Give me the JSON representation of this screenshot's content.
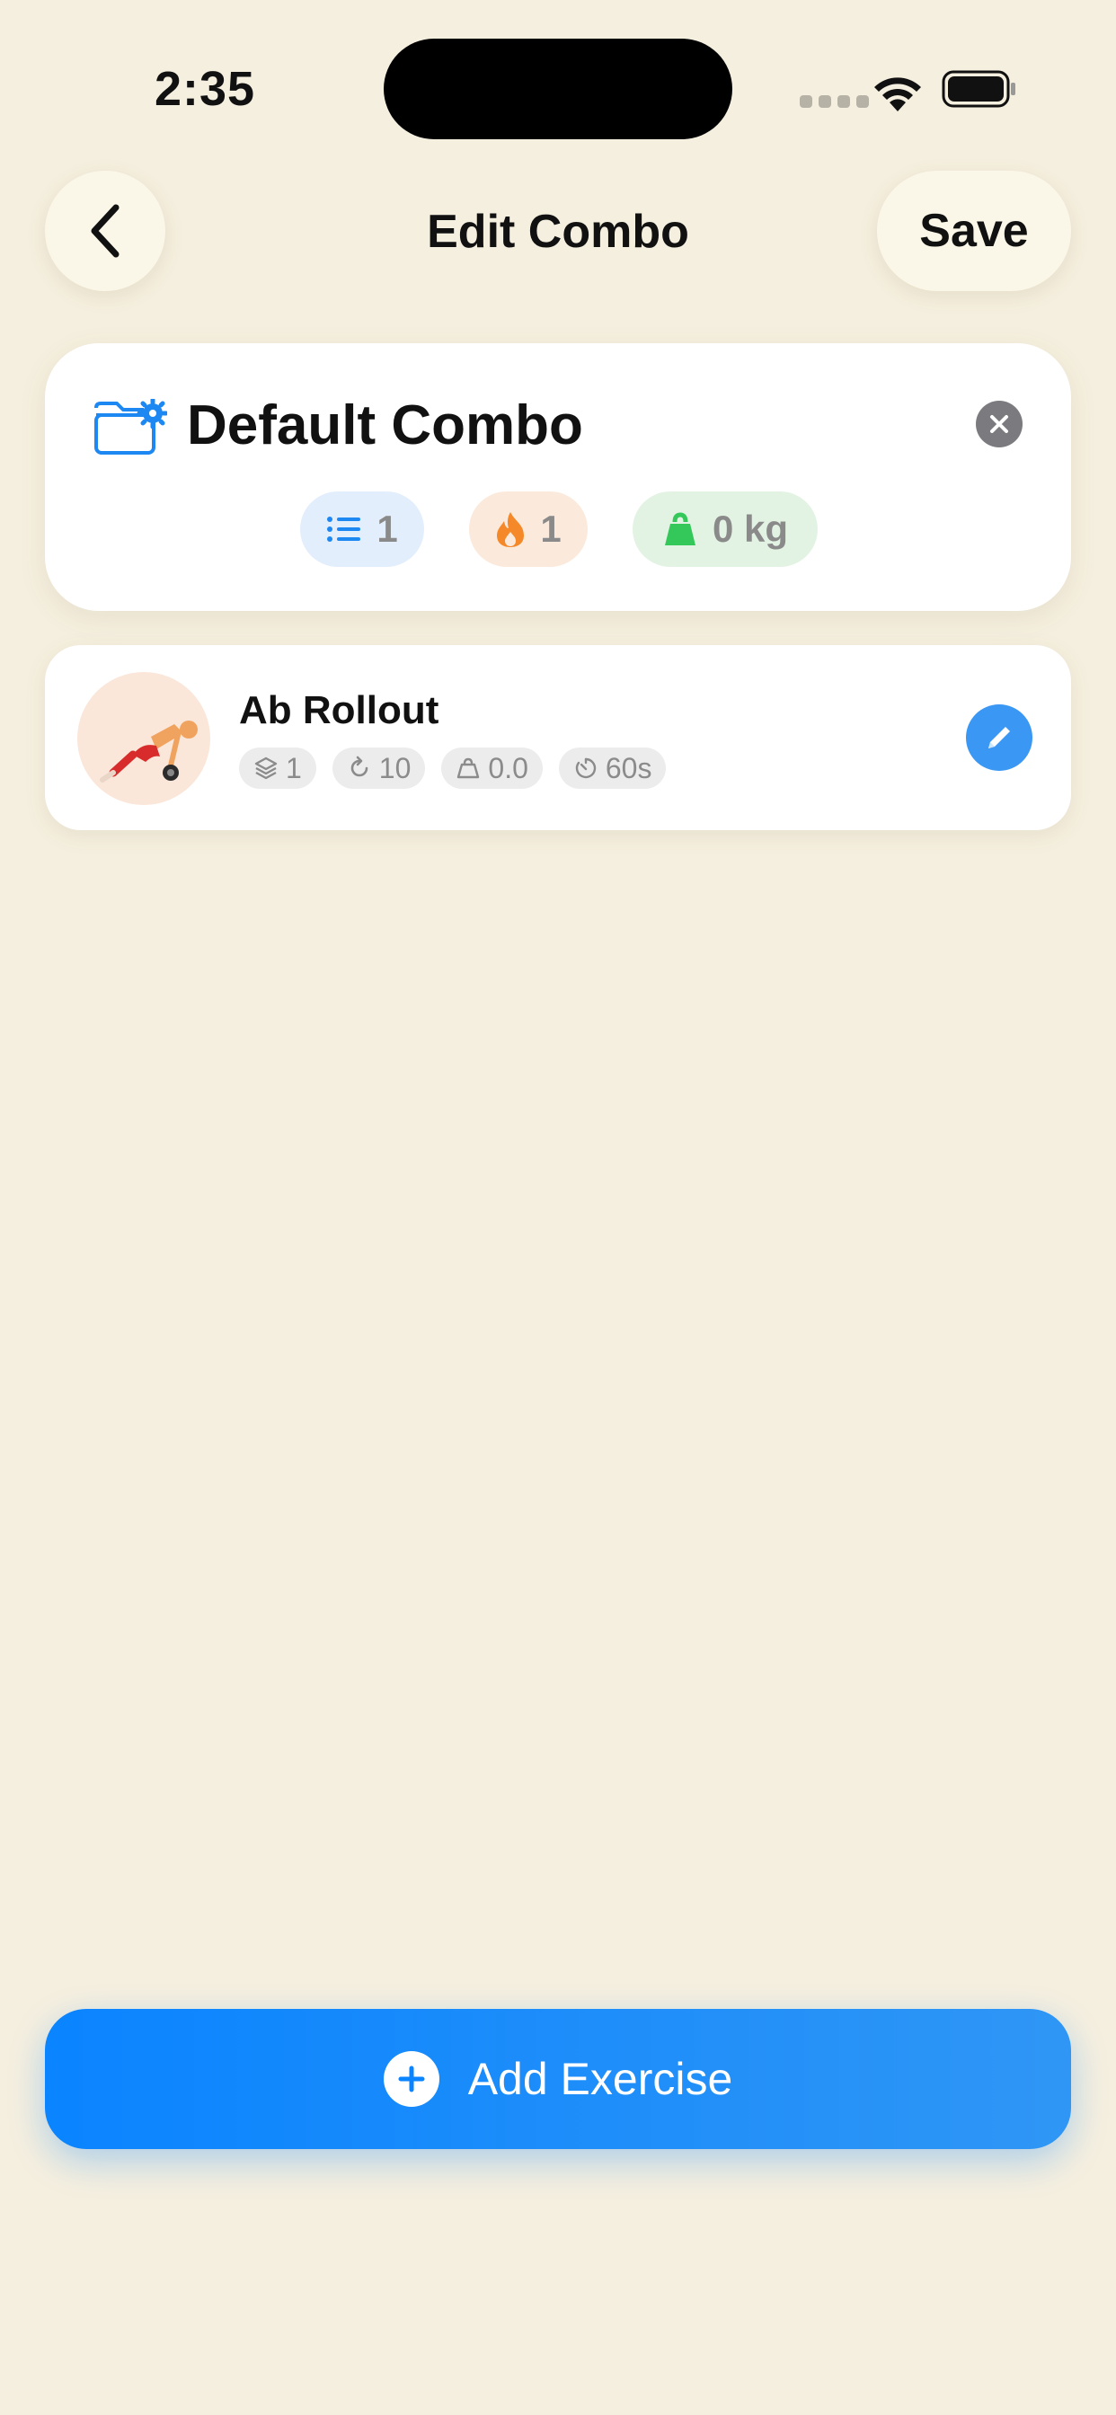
{
  "status_bar": {
    "time": "2:35"
  },
  "nav": {
    "title": "Edit Combo",
    "save_label": "Save"
  },
  "combo": {
    "name": "Default Combo",
    "stats": {
      "exercises": "1",
      "calories": "1",
      "weight": "0 kg"
    }
  },
  "exercises": [
    {
      "name": "Ab Rollout",
      "sets": "1",
      "reps": "10",
      "weight": "0.0",
      "rest": "60s"
    }
  ],
  "add_button": {
    "label": "Add Exercise"
  },
  "icons": {
    "back": "chevron-left-icon",
    "folder": "folder-gear-icon",
    "clear": "xmark-circle-icon",
    "list": "list-icon",
    "flame": "flame-icon",
    "weight": "kettlebell-icon",
    "sets": "layers-icon",
    "reps": "repeat-icon",
    "rest": "timer-icon",
    "edit": "pencil-icon",
    "add": "plus-circle-icon"
  },
  "colors": {
    "background": "#f5efdf",
    "accent": "#0a84ff",
    "edit": "#3a97f4",
    "flame": "#f5892a",
    "weight": "#34c759"
  }
}
